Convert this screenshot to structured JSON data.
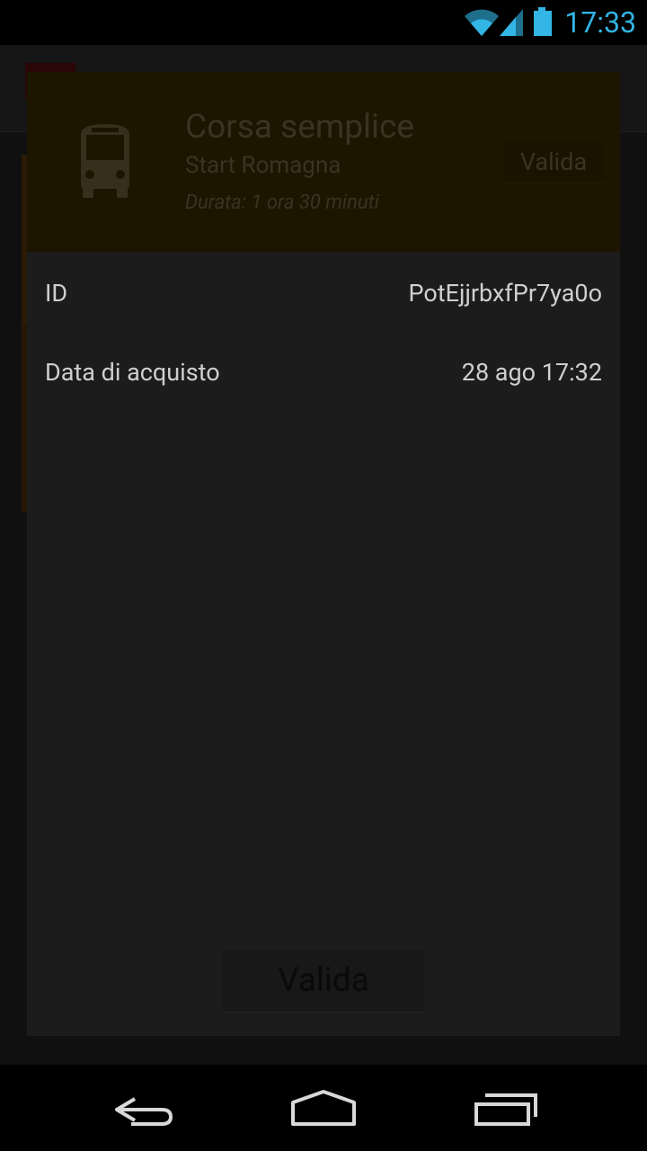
{
  "status_bar": {
    "time": "17:33",
    "accent_color": "#33b5e5",
    "icons": [
      "wifi-icon",
      "signal-icon",
      "battery-icon"
    ]
  },
  "ticket": {
    "title": "Corsa semplice",
    "company": "Start Romagna",
    "duration": "Durata: 1 ora 30 minuti",
    "header_button_label": "Valida",
    "icon": "bus-icon"
  },
  "details": [
    {
      "label": "ID",
      "value": "PotEjjrbxfPr7ya0o"
    },
    {
      "label": "Data di acquisto",
      "value": "28 ago 17:32"
    }
  ],
  "main_button_label": "Valida",
  "nav_bar": {
    "icons": [
      "back-icon",
      "home-icon",
      "recents-icon"
    ]
  }
}
